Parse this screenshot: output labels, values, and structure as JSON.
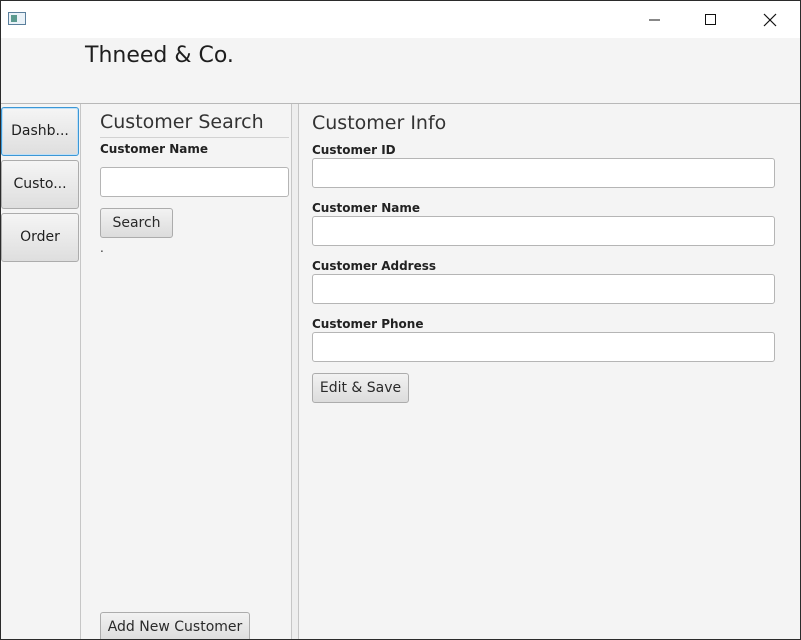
{
  "window": {
    "icon": "app-window-icon",
    "controls": [
      "minimize-icon",
      "maximize-icon",
      "close-icon"
    ]
  },
  "header": {
    "title": "Thneed & Co."
  },
  "nav": {
    "items": [
      {
        "label": "Dashb..."
      },
      {
        "label": "Custo..."
      },
      {
        "label": "Order"
      }
    ]
  },
  "search": {
    "title": "Customer Search",
    "name_label": "Customer Name",
    "name_value": "",
    "search_button": "Search",
    "status_text": ".",
    "add_button": "Add New Customer"
  },
  "info": {
    "title": "Customer Info",
    "fields": [
      {
        "label": "Customer ID",
        "value": ""
      },
      {
        "label": "Customer Name",
        "value": ""
      },
      {
        "label": "Customer Address",
        "value": ""
      },
      {
        "label": "Customer Phone",
        "value": ""
      }
    ],
    "edit_button": "Edit & Save"
  }
}
